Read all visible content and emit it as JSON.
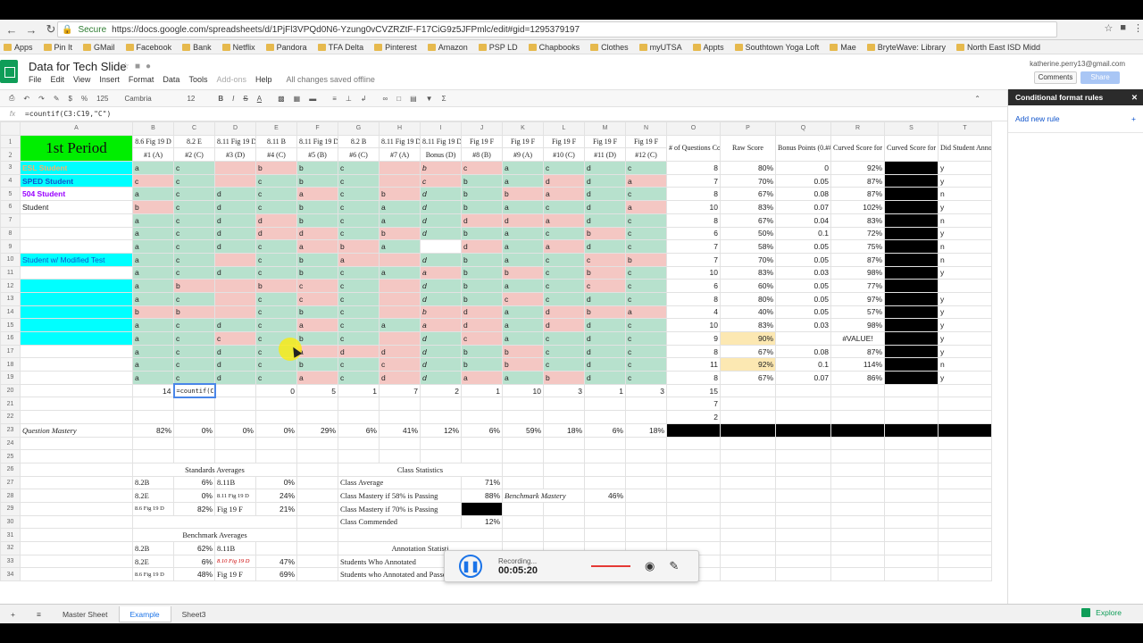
{
  "browser": {
    "secure_label": "Secure",
    "url": "https://docs.google.com/spreadsheets/d/1PjFl3VPQd0N6-Yzung0vCVZRZtF-F17CiG9z5JFPmlc/edit#gid=1295379197"
  },
  "bookmarks": [
    "Apps",
    "Pin It",
    "GMail",
    "Facebook",
    "Bank",
    "Netflix",
    "Pandora",
    "TFA Delta",
    "Pinterest",
    "Amazon",
    "PSP LD",
    "Chapbooks",
    "Clothes",
    "myUTSA",
    "Appts",
    "Southtown Yoga Loft",
    "Mae",
    "BryteWave: Library",
    "North East ISD Midd"
  ],
  "doc": {
    "title": "Data for Tech Slide",
    "menus": [
      "File",
      "Edit",
      "View",
      "Insert",
      "Format",
      "Data",
      "Tools",
      "Add-ons",
      "Help"
    ],
    "saved_status": "All changes saved offline",
    "user_email": "katherine.perry13@gmail.com",
    "comments_label": "Comments",
    "share_label": "Share"
  },
  "toolbar": {
    "zoom": "125",
    "font": "Cambria",
    "font_size": "12",
    "bold": "B",
    "italic": "I",
    "strike": "S",
    "underline": "A",
    "sigma": "Σ"
  },
  "formula_bar": {
    "fx_label": "fx",
    "value": "=countif(C3:C19,\"C\")"
  },
  "sheet": {
    "columns": [
      "A",
      "B",
      "C",
      "D",
      "E",
      "F",
      "G",
      "H",
      "I",
      "J",
      "K",
      "L",
      "M",
      "N",
      "O",
      "P",
      "Q",
      "R",
      "S",
      "T"
    ],
    "title": "1st Period",
    "header_top": [
      "8.6 Fig 19 D",
      "8.2 E",
      "8.11 Fig 19 D",
      "8.11 B",
      "8.11 Fig 19 D",
      "8.2 B",
      "8.11 Fig 19 D",
      "8.11 Fig 19 D",
      "Fig 19 F",
      "Fig 19 F",
      "Fig 19 F",
      "Fig 19 F",
      "Fig 19 F"
    ],
    "header_bottom": [
      "#1 (A)",
      "#2 (C)",
      "#3 (D)",
      "#4 (C)",
      "#5 (B)",
      "#6 (C)",
      "#7 (A)",
      "Bonus (D)",
      "#8 (B)",
      "#9 (A)",
      "#10 (C)",
      "#11 (D)",
      "#12 (C)"
    ],
    "header_extra": [
      "# of Questions Correct (No Bonus)",
      "Raw Score",
      "Bonus Points (0.##)",
      "Curved Score for Regulars (if 58% is passing)",
      "Curved Score for Pre-AP (if 70% is passing)",
      "Did Student Annotate? (y or n)"
    ],
    "rows": [
      {
        "n": "3",
        "label": "ESL Student",
        "label_color": "#f6b26b",
        "cells": [
          "a",
          "c",
          "",
          "b",
          "b",
          "c",
          "",
          "b",
          "c",
          "a",
          "c",
          "d",
          "c"
        ],
        "correct": "8",
        "raw": "80%",
        "bonus": "0",
        "curved": "92%",
        "ann": "y"
      },
      {
        "n": "4",
        "label": "SPED Student",
        "label_color": "#1155cc",
        "cells": [
          "c",
          "c",
          "",
          "c",
          "b",
          "c",
          "",
          "c",
          "b",
          "a",
          "d",
          "d",
          "a"
        ],
        "correct": "7",
        "raw": "70%",
        "bonus": "0.05",
        "curved": "87%",
        "ann": "y"
      },
      {
        "n": "5",
        "label": "504 Student",
        "label_color": "#9900ff",
        "cells": [
          "a",
          "c",
          "d",
          "c",
          "a",
          "c",
          "b",
          "d",
          "b",
          "b",
          "a",
          "d",
          "c"
        ],
        "correct": "8",
        "raw": "67%",
        "bonus": "0.08",
        "curved": "87%",
        "ann": "n"
      },
      {
        "n": "6",
        "label": "Student",
        "label_color": "#222222",
        "cells": [
          "b",
          "c",
          "d",
          "c",
          "b",
          "c",
          "a",
          "d",
          "b",
          "a",
          "c",
          "d",
          "a"
        ],
        "correct": "10",
        "raw": "83%",
        "bonus": "0.07",
        "curved": "102%",
        "ann": "y"
      },
      {
        "n": "7",
        "label": "",
        "label_color": "#222222",
        "cells": [
          "a",
          "c",
          "d",
          "d",
          "b",
          "c",
          "a",
          "d",
          "d",
          "d",
          "a",
          "d",
          "c"
        ],
        "correct": "8",
        "raw": "67%",
        "bonus": "0.04",
        "curved": "83%",
        "ann": "n"
      },
      {
        "n": "8",
        "label": "",
        "label_color": "#222222",
        "cells": [
          "a",
          "c",
          "d",
          "d",
          "d",
          "c",
          "b",
          "d",
          "b",
          "a",
          "c",
          "b",
          "c"
        ],
        "correct": "6",
        "raw": "50%",
        "bonus": "0.1",
        "curved": "72%",
        "ann": "y"
      },
      {
        "n": "9",
        "label": "",
        "label_color": "#222222",
        "cells": [
          "a",
          "c",
          "d",
          "c",
          "a",
          "b",
          "a",
          "",
          "d",
          "a",
          "a",
          "d",
          "c"
        ],
        "correct": "7",
        "raw": "58%",
        "bonus": "0.05",
        "curved": "75%",
        "ann": "n"
      },
      {
        "n": "10",
        "label": "Student w/ Modified Test",
        "label_color": "#1155cc",
        "cells": [
          "a",
          "c",
          "",
          "c",
          "b",
          "a",
          "",
          "d",
          "b",
          "a",
          "c",
          "c",
          "b"
        ],
        "correct": "7",
        "raw": "70%",
        "bonus": "0.05",
        "curved": "87%",
        "ann": "n"
      },
      {
        "n": "11",
        "label": "",
        "label_color": "#222222",
        "cells": [
          "a",
          "c",
          "d",
          "c",
          "b",
          "c",
          "a",
          "a",
          "b",
          "b",
          "c",
          "b",
          "c"
        ],
        "correct": "10",
        "raw": "83%",
        "bonus": "0.03",
        "curved": "98%",
        "ann": "y"
      },
      {
        "n": "12",
        "label": "",
        "label_color": "#222222",
        "cells": [
          "a",
          "b",
          "",
          "b",
          "c",
          "c",
          "",
          "d",
          "b",
          "a",
          "c",
          "c",
          "c"
        ],
        "correct": "6",
        "raw": "60%",
        "bonus": "0.05",
        "curved": "77%",
        "ann": ""
      },
      {
        "n": "13",
        "label": "",
        "label_color": "#222222",
        "cells": [
          "a",
          "c",
          "",
          "c",
          "c",
          "c",
          "",
          "d",
          "b",
          "c",
          "c",
          "d",
          "c"
        ],
        "correct": "8",
        "raw": "80%",
        "bonus": "0.05",
        "curved": "97%",
        "ann": "y"
      },
      {
        "n": "14",
        "label": "",
        "label_color": "#222222",
        "cells": [
          "b",
          "b",
          "",
          "c",
          "b",
          "c",
          "",
          "b",
          "d",
          "a",
          "d",
          "b",
          "a"
        ],
        "correct": "4",
        "raw": "40%",
        "bonus": "0.05",
        "curved": "57%",
        "ann": "y"
      },
      {
        "n": "15",
        "label": "",
        "label_color": "#222222",
        "cells": [
          "a",
          "c",
          "d",
          "c",
          "a",
          "c",
          "a",
          "a",
          "d",
          "a",
          "d",
          "d",
          "c"
        ],
        "correct": "10",
        "raw": "83%",
        "bonus": "0.03",
        "curved": "98%",
        "ann": "y"
      },
      {
        "n": "16",
        "label": "",
        "label_color": "#222222",
        "cells": [
          "a",
          "c",
          "c",
          "c",
          "b",
          "c",
          "",
          "d",
          "c",
          "a",
          "c",
          "d",
          "c"
        ],
        "correct": "9",
        "raw": "90%",
        "bonus": "",
        "curved": "#VALUE!",
        "ann": "y"
      },
      {
        "n": "17",
        "label": "",
        "label_color": "#222222",
        "cells": [
          "a",
          "c",
          "d",
          "c",
          "a",
          "d",
          "d",
          "d",
          "b",
          "b",
          "c",
          "d",
          "c"
        ],
        "correct": "8",
        "raw": "67%",
        "bonus": "0.08",
        "curved": "87%",
        "ann": "y"
      },
      {
        "n": "18",
        "label": "",
        "label_color": "#222222",
        "cells": [
          "a",
          "c",
          "d",
          "c",
          "b",
          "c",
          "c",
          "d",
          "b",
          "b",
          "c",
          "d",
          "c"
        ],
        "correct": "11",
        "raw": "92%",
        "bonus": "0.1",
        "curved": "114%",
        "ann": "n"
      },
      {
        "n": "19",
        "label": "",
        "label_color": "#222222",
        "cells": [
          "a",
          "c",
          "d",
          "c",
          "a",
          "c",
          "d",
          "d",
          "a",
          "a",
          "b",
          "d",
          "c"
        ],
        "correct": "8",
        "raw": "67%",
        "bonus": "0.07",
        "curved": "86%",
        "ann": "y"
      }
    ],
    "row20": {
      "n": "20",
      "b": "14",
      "c": "=countif(C3:C19,\"C\")",
      "e": "0",
      "f": "5",
      "g": "1",
      "h": "7",
      "i": "2",
      "j": "1",
      "k": "10",
      "l": "3",
      "m": "1",
      "n_col": "3",
      "o": "15"
    },
    "row21": {
      "n": "21",
      "o": "7"
    },
    "row22": {
      "n": "22",
      "o": "2"
    },
    "row23": {
      "n": "23",
      "label": "Question Mastery",
      "values": [
        "82%",
        "0%",
        "0%",
        "0%",
        "29%",
        "6%",
        "41%",
        "12%",
        "6%",
        "59%",
        "18%",
        "6%",
        "18%"
      ]
    },
    "standards": {
      "title": "Standards Averages",
      "rows": [
        {
          "n": "27",
          "a": "8.2B",
          "av": "6%",
          "b": "8.11B",
          "bv": "0%"
        },
        {
          "n": "28",
          "a": "8.2E",
          "av": "0%",
          "b": "8.11 Fig 19 D",
          "bv": "24%"
        },
        {
          "n": "29",
          "a": "8.6 Fig 19 D",
          "av": "82%",
          "b": "Fig 19 F",
          "bv": "21%"
        }
      ]
    },
    "benchmark": {
      "title": "Benchmark Averages",
      "rows": [
        {
          "n": "32",
          "a": "8.2B",
          "av": "62%",
          "b": "8.11B",
          "bv": ""
        },
        {
          "n": "33",
          "a": "8.2E",
          "av": "6%",
          "b": "8.10 Fig 19 D",
          "bv": "47%"
        },
        {
          "n": "34",
          "a": "8.6 Fig 19 D",
          "av": "48%",
          "b": "Fig 19 F",
          "bv": "69%"
        }
      ]
    },
    "class_stats": {
      "title": "Class Statistics",
      "rows": [
        {
          "label": "Class Average",
          "value": "71%"
        },
        {
          "label": "Class Mastery if 58% is Passing",
          "value": "88%"
        },
        {
          "label": "Class Mastery if 70% is Passing",
          "value": ""
        },
        {
          "label": "Class Commended",
          "value": "12%"
        }
      ],
      "benchmark_mastery_label": "Benchmark Mastery",
      "benchmark_mastery_value": "46%"
    },
    "annotation_stats": {
      "title": "Annotation Statisti",
      "rows": [
        {
          "label": "Students Who Annotated",
          "value": ""
        },
        {
          "label": "Students who Annotated and Passed",
          "value": "80%"
        }
      ]
    }
  },
  "side_panel": {
    "title": "Conditional format rules",
    "add_rule": "Add new rule"
  },
  "tabs": [
    {
      "label": "Master Sheet",
      "active": false
    },
    {
      "label": "Example",
      "active": true
    },
    {
      "label": "Sheet3",
      "active": false
    }
  ],
  "explore_label": "Explore",
  "recorder": {
    "label": "Recording...",
    "time": "00:05:20"
  },
  "colors": {
    "correct_green": "#b7e1cd",
    "wrong_red": "#f4c7c3",
    "title_green": "#00ee00",
    "label_cyan": "#00ffff"
  }
}
